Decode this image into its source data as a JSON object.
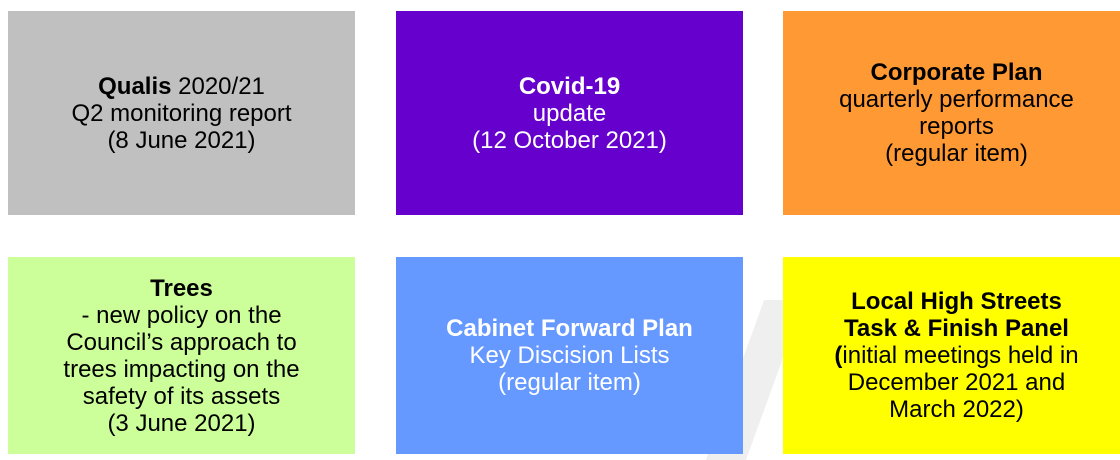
{
  "tiles": {
    "qualis": {
      "color": "#c0c0c0",
      "title": "Qualis",
      "title_suffix": " 2020/21",
      "line2": "Q2 monitoring report",
      "line3": "(8 June 2021)"
    },
    "covid": {
      "color": "#6600cc",
      "title": "Covid-19",
      "line2": "update",
      "line3": "(12 October 2021)"
    },
    "corporate": {
      "color": "#ff9933",
      "title": "Corporate Plan",
      "line2": "quarterly performance",
      "line3": "reports",
      "line4": "(regular item)"
    },
    "trees": {
      "color": "#ccff99",
      "title": "Trees",
      "line2": "- new policy on the",
      "line3": "Council’s approach to",
      "line4": "trees impacting on the",
      "line5": "safety of its assets",
      "line6": "(3 June 2021)"
    },
    "cabinet": {
      "color": "#6699ff",
      "title": "Cabinet Forward Plan",
      "line2": "Key Discision Lists",
      "line3": "(regular item)"
    },
    "highstreets": {
      "color": "#ffff00",
      "title": "Local High Streets",
      "title2": "Task & Finish Panel",
      "paren": "(",
      "line3": "initial meetings held in",
      "line4": "December 2021 and",
      "line5": "March 2022)"
    }
  }
}
